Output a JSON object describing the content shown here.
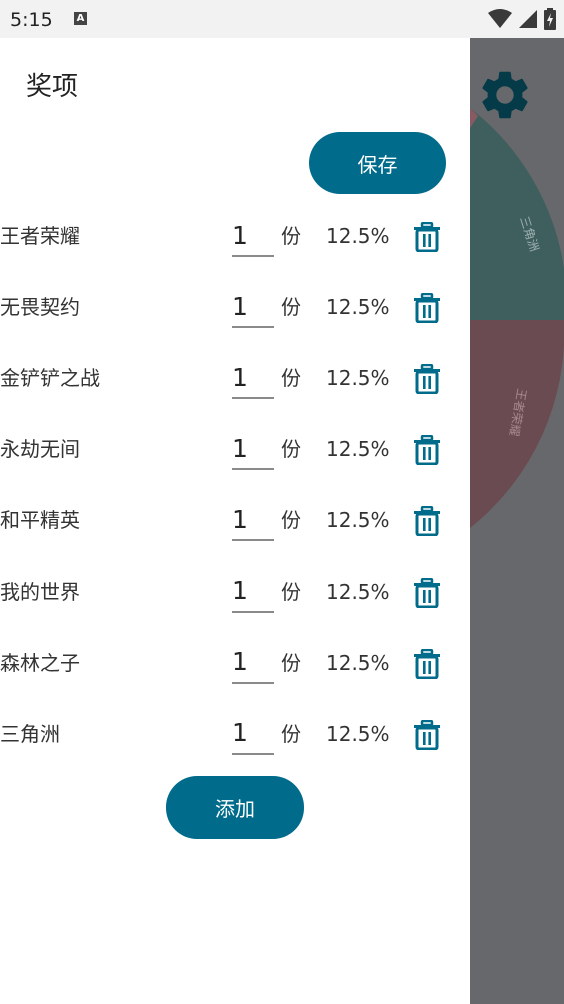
{
  "status_bar": {
    "time": "5:15",
    "notification_badge": "A",
    "icons": [
      "wifi-icon",
      "signal-icon",
      "battery-charging-icon"
    ]
  },
  "drawer": {
    "title": "奖项",
    "save_label": "保存",
    "add_label": "添加",
    "unit_label": "份",
    "items": [
      {
        "name": "王者荣耀",
        "qty": "1",
        "pct": "12.5%"
      },
      {
        "name": "无畏契约",
        "qty": "1",
        "pct": "12.5%"
      },
      {
        "name": "金铲铲之战",
        "qty": "1",
        "pct": "12.5%"
      },
      {
        "name": "永劫无间",
        "qty": "1",
        "pct": "12.5%"
      },
      {
        "name": "和平精英",
        "qty": "1",
        "pct": "12.5%"
      },
      {
        "name": "我的世界",
        "qty": "1",
        "pct": "12.5%"
      },
      {
        "name": "森林之子",
        "qty": "1",
        "pct": "12.5%"
      },
      {
        "name": "三角洲",
        "qty": "1",
        "pct": "12.5%"
      }
    ]
  },
  "background": {
    "wheel_labels": [
      "三角洲",
      "王者荣耀"
    ],
    "settings_icon": "gear-icon"
  },
  "colors": {
    "accent": "#006b8a",
    "overlay": "#67686b",
    "wheel_teal": "#3f5f5f",
    "wheel_red": "#6b4b52"
  }
}
